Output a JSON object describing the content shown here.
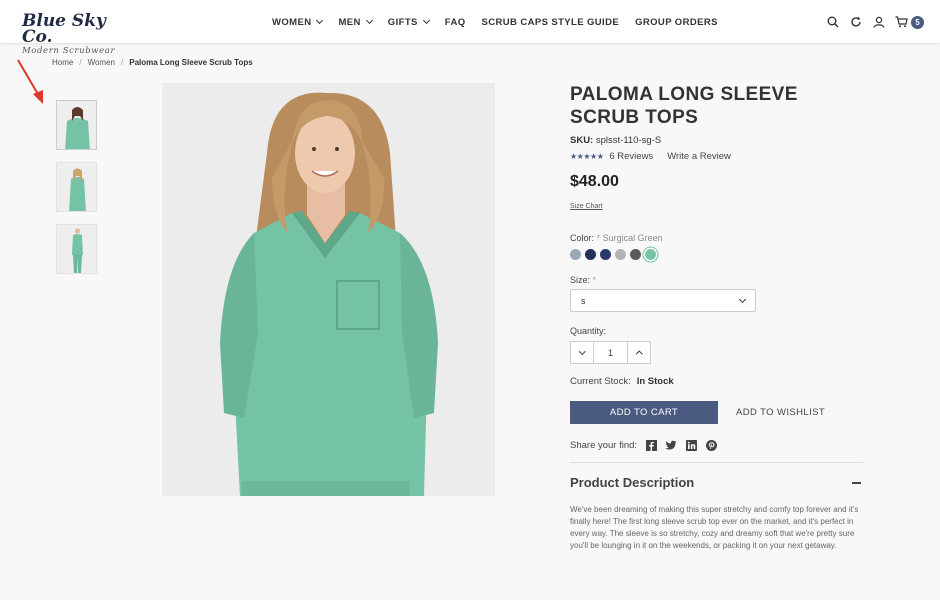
{
  "header": {
    "logo_main": "Blue Sky Co.",
    "logo_sub": "Modern Scrubwear",
    "nav": [
      {
        "label": "WOMEN",
        "dropdown": true
      },
      {
        "label": "MEN",
        "dropdown": true
      },
      {
        "label": "GIFTS",
        "dropdown": true
      },
      {
        "label": "FAQ",
        "dropdown": false
      },
      {
        "label": "SCRUB CAPS STYLE GUIDE",
        "dropdown": false
      },
      {
        "label": "GROUP ORDERS",
        "dropdown": false
      }
    ],
    "icons": [
      "search-icon",
      "refresh-icon",
      "account-icon",
      "cart-icon"
    ],
    "cart_count": "5"
  },
  "breadcrumb": {
    "items": [
      "Home",
      "Women"
    ],
    "current": "Paloma Long Sleeve Scrub Tops"
  },
  "product": {
    "title": "PALOMA LONG SLEEVE SCRUB TOPS",
    "sku_label": "SKU:",
    "sku": "splsst-110-sg-S",
    "stars": "★★★★★",
    "reviews": "6 Reviews",
    "write_review": "Write a Review",
    "price": "$48.00",
    "size_chart": "Size Chart",
    "color_label": "Color:",
    "required_mark": "*",
    "color_value": "Surgical Green",
    "swatches": [
      {
        "name": "Ceil Blue",
        "color": "#9aa8b8"
      },
      {
        "name": "Navy",
        "color": "#253257"
      },
      {
        "name": "Royal Navy",
        "color": "#2b3a6b"
      },
      {
        "name": "Gray",
        "color": "#b4b4b4"
      },
      {
        "name": "Charcoal",
        "color": "#5b5b5e"
      },
      {
        "name": "Surgical Green",
        "color": "#74c3a4",
        "selected": true
      }
    ],
    "size_label": "Size:",
    "size_value": "s",
    "quantity_label": "Quantity:",
    "quantity": "1",
    "stock_label": "Current Stock:",
    "stock_value": "In Stock",
    "add_to_cart": "ADD TO CART",
    "add_to_wishlist": "ADD TO WISHLIST",
    "share_label": "Share your find:",
    "share_icons": [
      "facebook-icon",
      "twitter-icon",
      "linkedin-icon",
      "pinterest-icon"
    ],
    "description_title": "Product Description",
    "description": "We've been dreaming of making this super stretchy and comfy top forever and it's finally here! The first long sleeve scrub top ever on the market, and it's perfect in every way. The sleeve is so stretchy, cozy and dreamy soft that we're pretty sure you'll be lounging in it on the weekends, or packing it on your next getaway."
  },
  "colors": {
    "accent": "#4a5a80",
    "scrub": "#74c3a4",
    "arrow": "#e0352b"
  }
}
